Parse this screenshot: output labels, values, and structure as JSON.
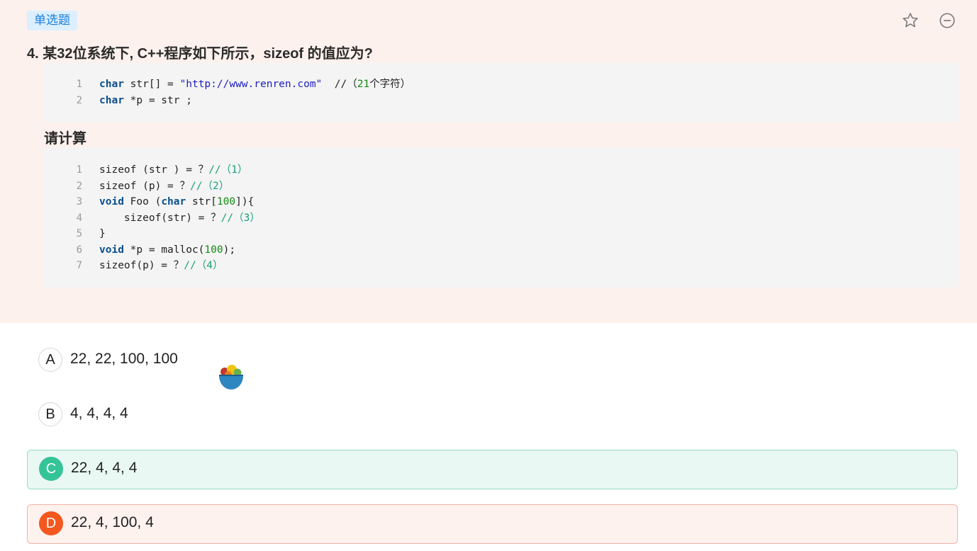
{
  "question": {
    "type_tag": "单选题",
    "title": "4. 某32位系统下, C++程序如下所示，sizeof 的值应为?",
    "sub_title": "请计算"
  },
  "toolbar": {
    "favorite_icon": "star-outline-icon",
    "remove_icon": "minus-circle-icon"
  },
  "code_block_1": {
    "lines": [
      {
        "no": "1",
        "tokens": [
          {
            "t": "char",
            "c": "kw"
          },
          {
            "t": " str[] = "
          },
          {
            "t": "\"http://www.renren.com\"",
            "c": "str"
          },
          {
            "t": "  //（"
          },
          {
            "t": "21",
            "c": "num"
          },
          {
            "t": "个字符）"
          }
        ]
      },
      {
        "no": "2",
        "tokens": [
          {
            "t": "char",
            "c": "kw"
          },
          {
            "t": " *p = str ;"
          }
        ]
      }
    ]
  },
  "code_block_2": {
    "lines": [
      {
        "no": "1",
        "tokens": [
          {
            "t": "sizeof (str ) = ？"
          },
          {
            "t": "//（1）",
            "c": "cmt"
          }
        ]
      },
      {
        "no": "2",
        "tokens": [
          {
            "t": "sizeof (p) = ？"
          },
          {
            "t": "//（2）",
            "c": "cmt"
          }
        ]
      },
      {
        "no": "3",
        "tokens": [
          {
            "t": "void",
            "c": "kw"
          },
          {
            "t": " Foo ("
          },
          {
            "t": "char",
            "c": "kw"
          },
          {
            "t": " str["
          },
          {
            "t": "100",
            "c": "num"
          },
          {
            "t": "]){"
          }
        ]
      },
      {
        "no": "4",
        "tokens": [
          {
            "t": "    sizeof(str) = ？"
          },
          {
            "t": "//（3）",
            "c": "cmt"
          }
        ]
      },
      {
        "no": "5",
        "tokens": [
          {
            "t": "}"
          }
        ]
      },
      {
        "no": "6",
        "tokens": [
          {
            "t": "void",
            "c": "kw"
          },
          {
            "t": " *p = malloc("
          },
          {
            "t": "100",
            "c": "num"
          },
          {
            "t": ");"
          }
        ]
      },
      {
        "no": "7",
        "tokens": [
          {
            "t": "sizeof(p) = ？"
          },
          {
            "t": "//（4）",
            "c": "cmt"
          }
        ]
      }
    ]
  },
  "options": [
    {
      "letter": "A",
      "text": "22, 22, 100, 100",
      "state": "normal"
    },
    {
      "letter": "B",
      "text": "4, 4, 4, 4",
      "state": "normal"
    },
    {
      "letter": "C",
      "text": "22, 4, 4, 4",
      "state": "correct"
    },
    {
      "letter": "D",
      "text": "22, 4, 100, 4",
      "state": "wrong"
    }
  ],
  "colors": {
    "panel_bg": "#fdf1ee",
    "tag_bg": "#dcefff",
    "tag_text": "#1a7fd9",
    "correct": "#35c497",
    "wrong": "#f5581f"
  },
  "floating_icon": "fruit-bowl-icon"
}
